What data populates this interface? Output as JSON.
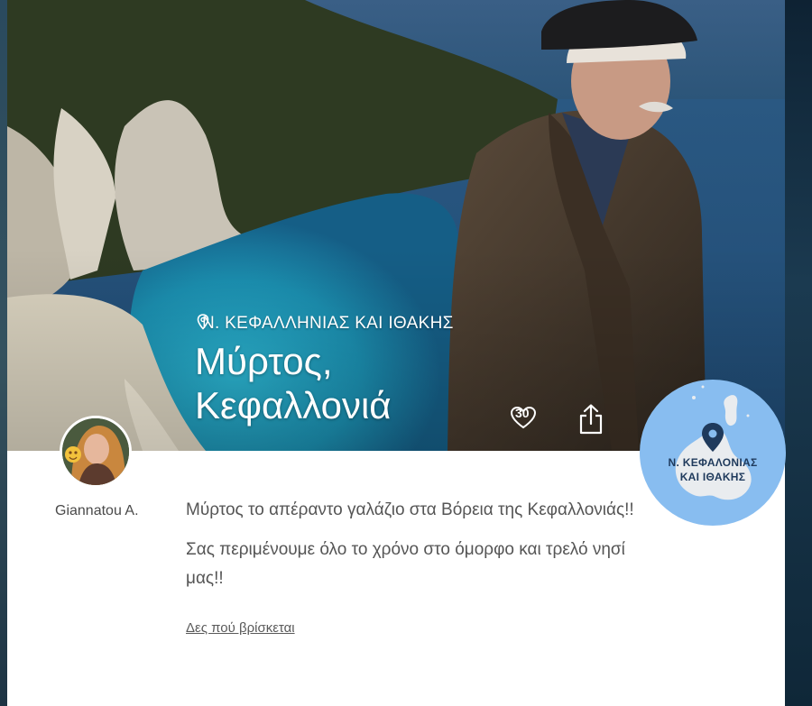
{
  "hero": {
    "region": "Ν. ΚΕΦΑΛΛΗΝΙΑΣ ΚΑΙ ΙΘΑΚΗΣ",
    "title_line1": "Μύρτος,",
    "title_line2": "Κεφαλλονιά",
    "like_count": "30"
  },
  "author": {
    "name": "Giannatou A."
  },
  "body": {
    "paragraphs": [
      "Μύρτος το απέραντο γαλάζιο στα Βόρεια της Κεφαλλονιάς!!",
      "Σας περιμένουμε όλο το χρόνο στο όμορφο και τρελό νησί μας!!"
    ],
    "map_link": "Δες πού βρίσκεται"
  },
  "map_badge": {
    "line1": "Ν. ΚΕΦΑΛΟΝΙΑΣ",
    "line2": "ΚΑΙ ΙΘΑΚΗΣ"
  },
  "colors": {
    "sea": "#1b8fb0",
    "map_bg": "#88bdf0",
    "pin": "#1f3a5c"
  },
  "icons": [
    "location-pin-icon",
    "heart-icon",
    "share-icon",
    "map-pin-icon"
  ]
}
